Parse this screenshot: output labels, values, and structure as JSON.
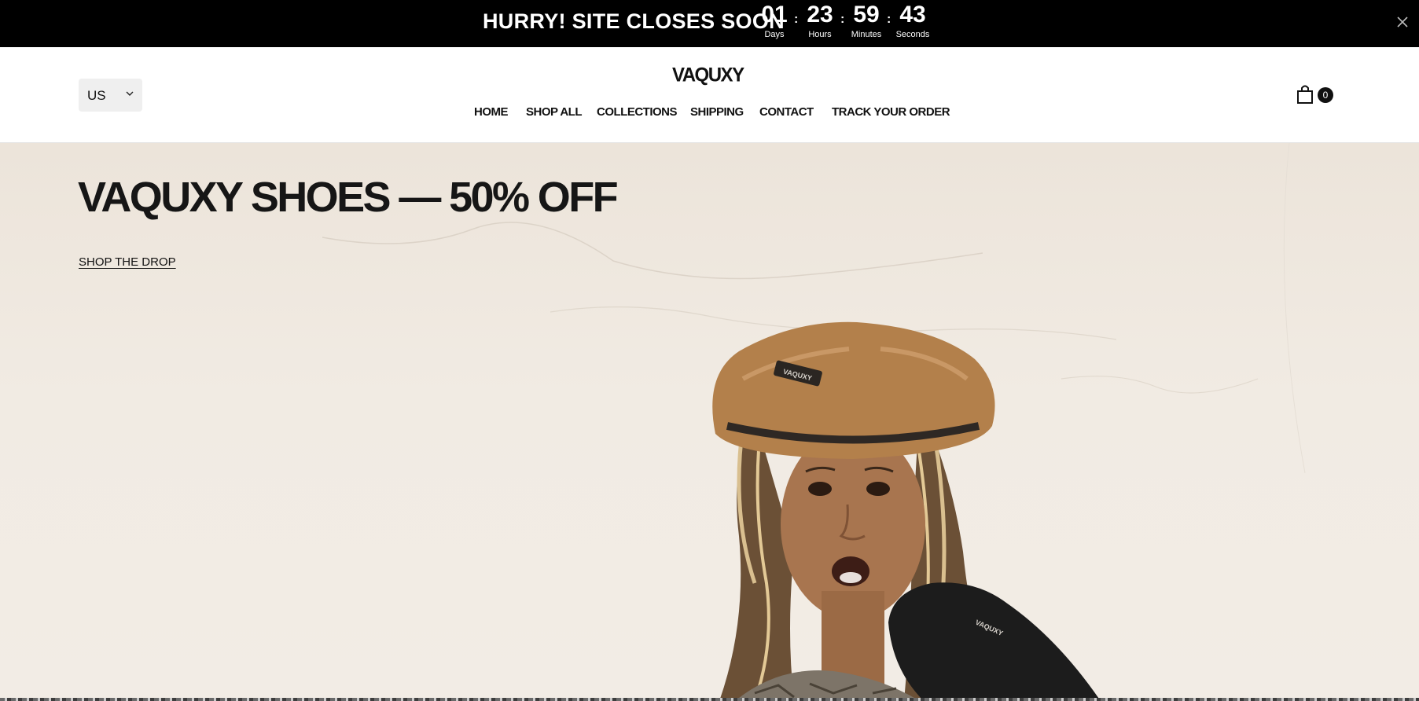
{
  "announcement": {
    "message": "HURRY! SITE CLOSES SOON",
    "countdown": [
      {
        "value": "01",
        "label": "Days"
      },
      {
        "value": "23",
        "label": "Hours"
      },
      {
        "value": "59",
        "label": "Minutes"
      },
      {
        "value": "43",
        "label": "Seconds"
      }
    ],
    "separator": ":",
    "close_icon": "close-icon"
  },
  "header": {
    "country_selector": {
      "value": "US",
      "icon": "chevron-down-icon"
    },
    "logo": "VAQUXY",
    "nav": [
      "HOME",
      "SHOP ALL",
      "COLLECTIONS",
      "SHIPPING",
      "CONTACT",
      "TRACK YOUR ORDER"
    ],
    "cart": {
      "icon": "shopping-bag-icon",
      "count": "0"
    }
  },
  "hero": {
    "title": "VAQUXY SHOES — 50% OFF",
    "cta": "SHOP THE DROP",
    "hat_label": "VAQUXY",
    "glove_label": "VAQUXY"
  },
  "colors": {
    "announcement_bg": "#000000",
    "hero_bg": "#efe8df",
    "accent": "#111111",
    "hat": "#b07a45"
  }
}
